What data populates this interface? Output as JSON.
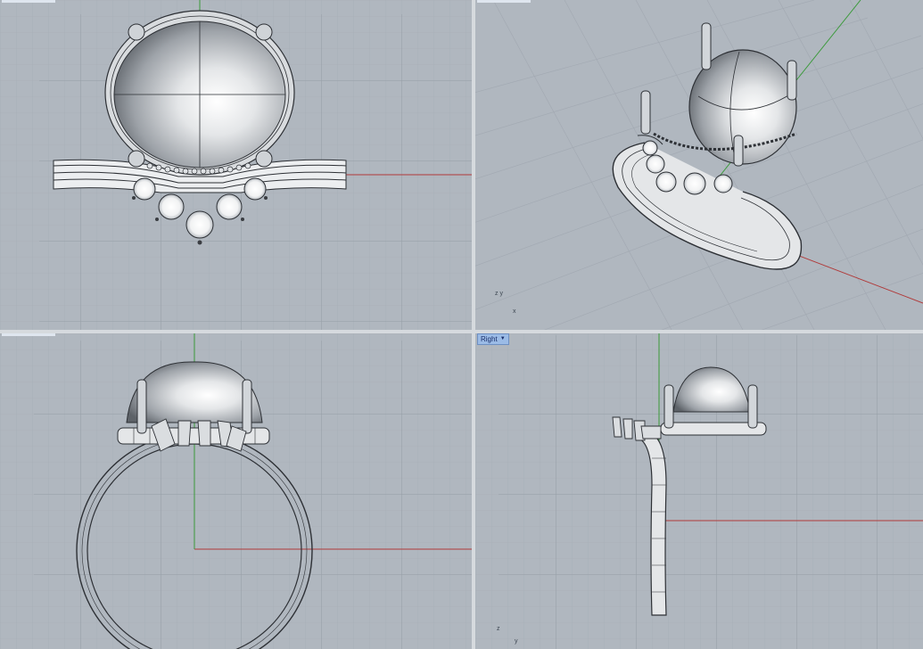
{
  "viewports": {
    "top": {
      "name": ""
    },
    "perspective": {
      "name": "",
      "axis_labels": {
        "x": "x",
        "y": "y",
        "z": "z"
      }
    },
    "front": {
      "name": ""
    },
    "right": {
      "name": "Right",
      "axis_labels": {
        "z": "z",
        "y": "y"
      }
    }
  },
  "colors": {
    "viewport_bg": "#b0b7bf",
    "grid_minor": "#a4abb3",
    "grid_major": "#99a1aa",
    "x_axis": "#b03a3a",
    "y_axis": "#3a9a3a",
    "model_wire": "#2d3035",
    "metal": "#e6e8ea",
    "tab_bg": "#9bbbe6"
  },
  "icons": {
    "dropdown": "triangle-down-icon"
  }
}
